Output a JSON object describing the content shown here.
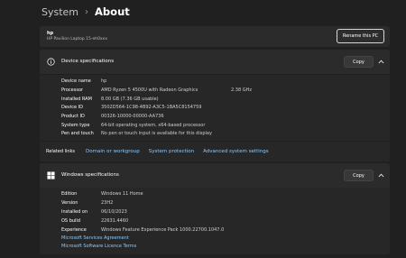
{
  "breadcrumb": {
    "parent": "System",
    "separator": "›",
    "current": "About"
  },
  "device": {
    "name": "hp",
    "model": "HP Pavilion Laptop 15-eh0xxx",
    "rename_label": "Rename this PC"
  },
  "device_specs": {
    "title": "Device specifications",
    "copy_label": "Copy",
    "rows": [
      {
        "label": "Device name",
        "value": "hp"
      },
      {
        "label": "Processor",
        "value": "AMD Ryzen 5 4500U with Radeon Graphics",
        "extra": "2.38 GHz"
      },
      {
        "label": "Installed RAM",
        "value": "8.00 GB (7.36 GB usable)"
      },
      {
        "label": "Device ID",
        "value": "3502D564-1C98-4B92-A3C5-1BA5C8154759"
      },
      {
        "label": "Product ID",
        "value": "00326-10000-00000-AA736"
      },
      {
        "label": "System type",
        "value": "64-bit operating system, x64-based processor"
      },
      {
        "label": "Pen and touch",
        "value": "No pen or touch input is available for this display"
      }
    ]
  },
  "related": {
    "label": "Related links",
    "links": [
      "Domain or workgroup",
      "System protection",
      "Advanced system settings"
    ]
  },
  "windows_specs": {
    "title": "Windows specifications",
    "copy_label": "Copy",
    "rows": [
      {
        "label": "Edition",
        "value": "Windows 11 Home"
      },
      {
        "label": "Version",
        "value": "23H2"
      },
      {
        "label": "Installed on",
        "value": "06/10/2023"
      },
      {
        "label": "OS build",
        "value": "22631.4460"
      },
      {
        "label": "Experience",
        "value": "Windows Feature Experience Pack 1000.22700.1047.0"
      }
    ],
    "links": [
      "Microsoft Services Agreement",
      "Microsoft Software Licence Terms"
    ]
  },
  "colors": {
    "background": "#202020",
    "card": "#2b2b2b",
    "link": "#8ec8f8"
  },
  "icons": {
    "spec": "info-icon",
    "windows": "windows-logo-icon",
    "collapse": "chevron-up-icon"
  }
}
